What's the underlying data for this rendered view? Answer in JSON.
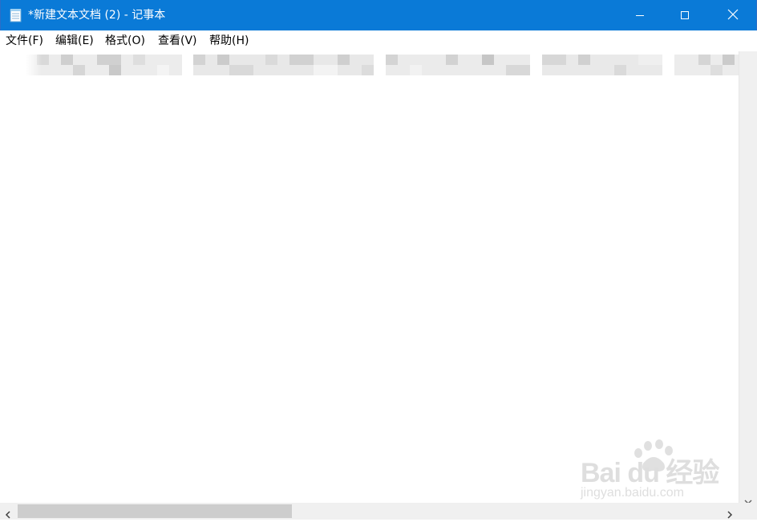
{
  "window": {
    "title": "*新建文本文档 (2) - 记事本",
    "app_icon": "notepad-icon",
    "buttons": {
      "minimize_icon": "minimize-icon",
      "maximize_icon": "maximize-icon",
      "close_icon": "close-icon"
    },
    "accent": "#0a7ad7"
  },
  "menu": {
    "items": [
      {
        "label": "文件(F)"
      },
      {
        "label": "编辑(E)"
      },
      {
        "label": "格式(O)"
      },
      {
        "label": "查看(V)"
      },
      {
        "label": "帮助(H)"
      }
    ]
  },
  "editor": {
    "content": ""
  },
  "scrollbars": {
    "horizontal_thumb_fraction": 0.39,
    "left_icon": "chevron-left-icon",
    "right_icon": "chevron-right-icon",
    "down_icon": "chevron-down-icon"
  },
  "watermark": {
    "brand": "Bai du 经验",
    "url": "jingyan.baidu.com"
  }
}
